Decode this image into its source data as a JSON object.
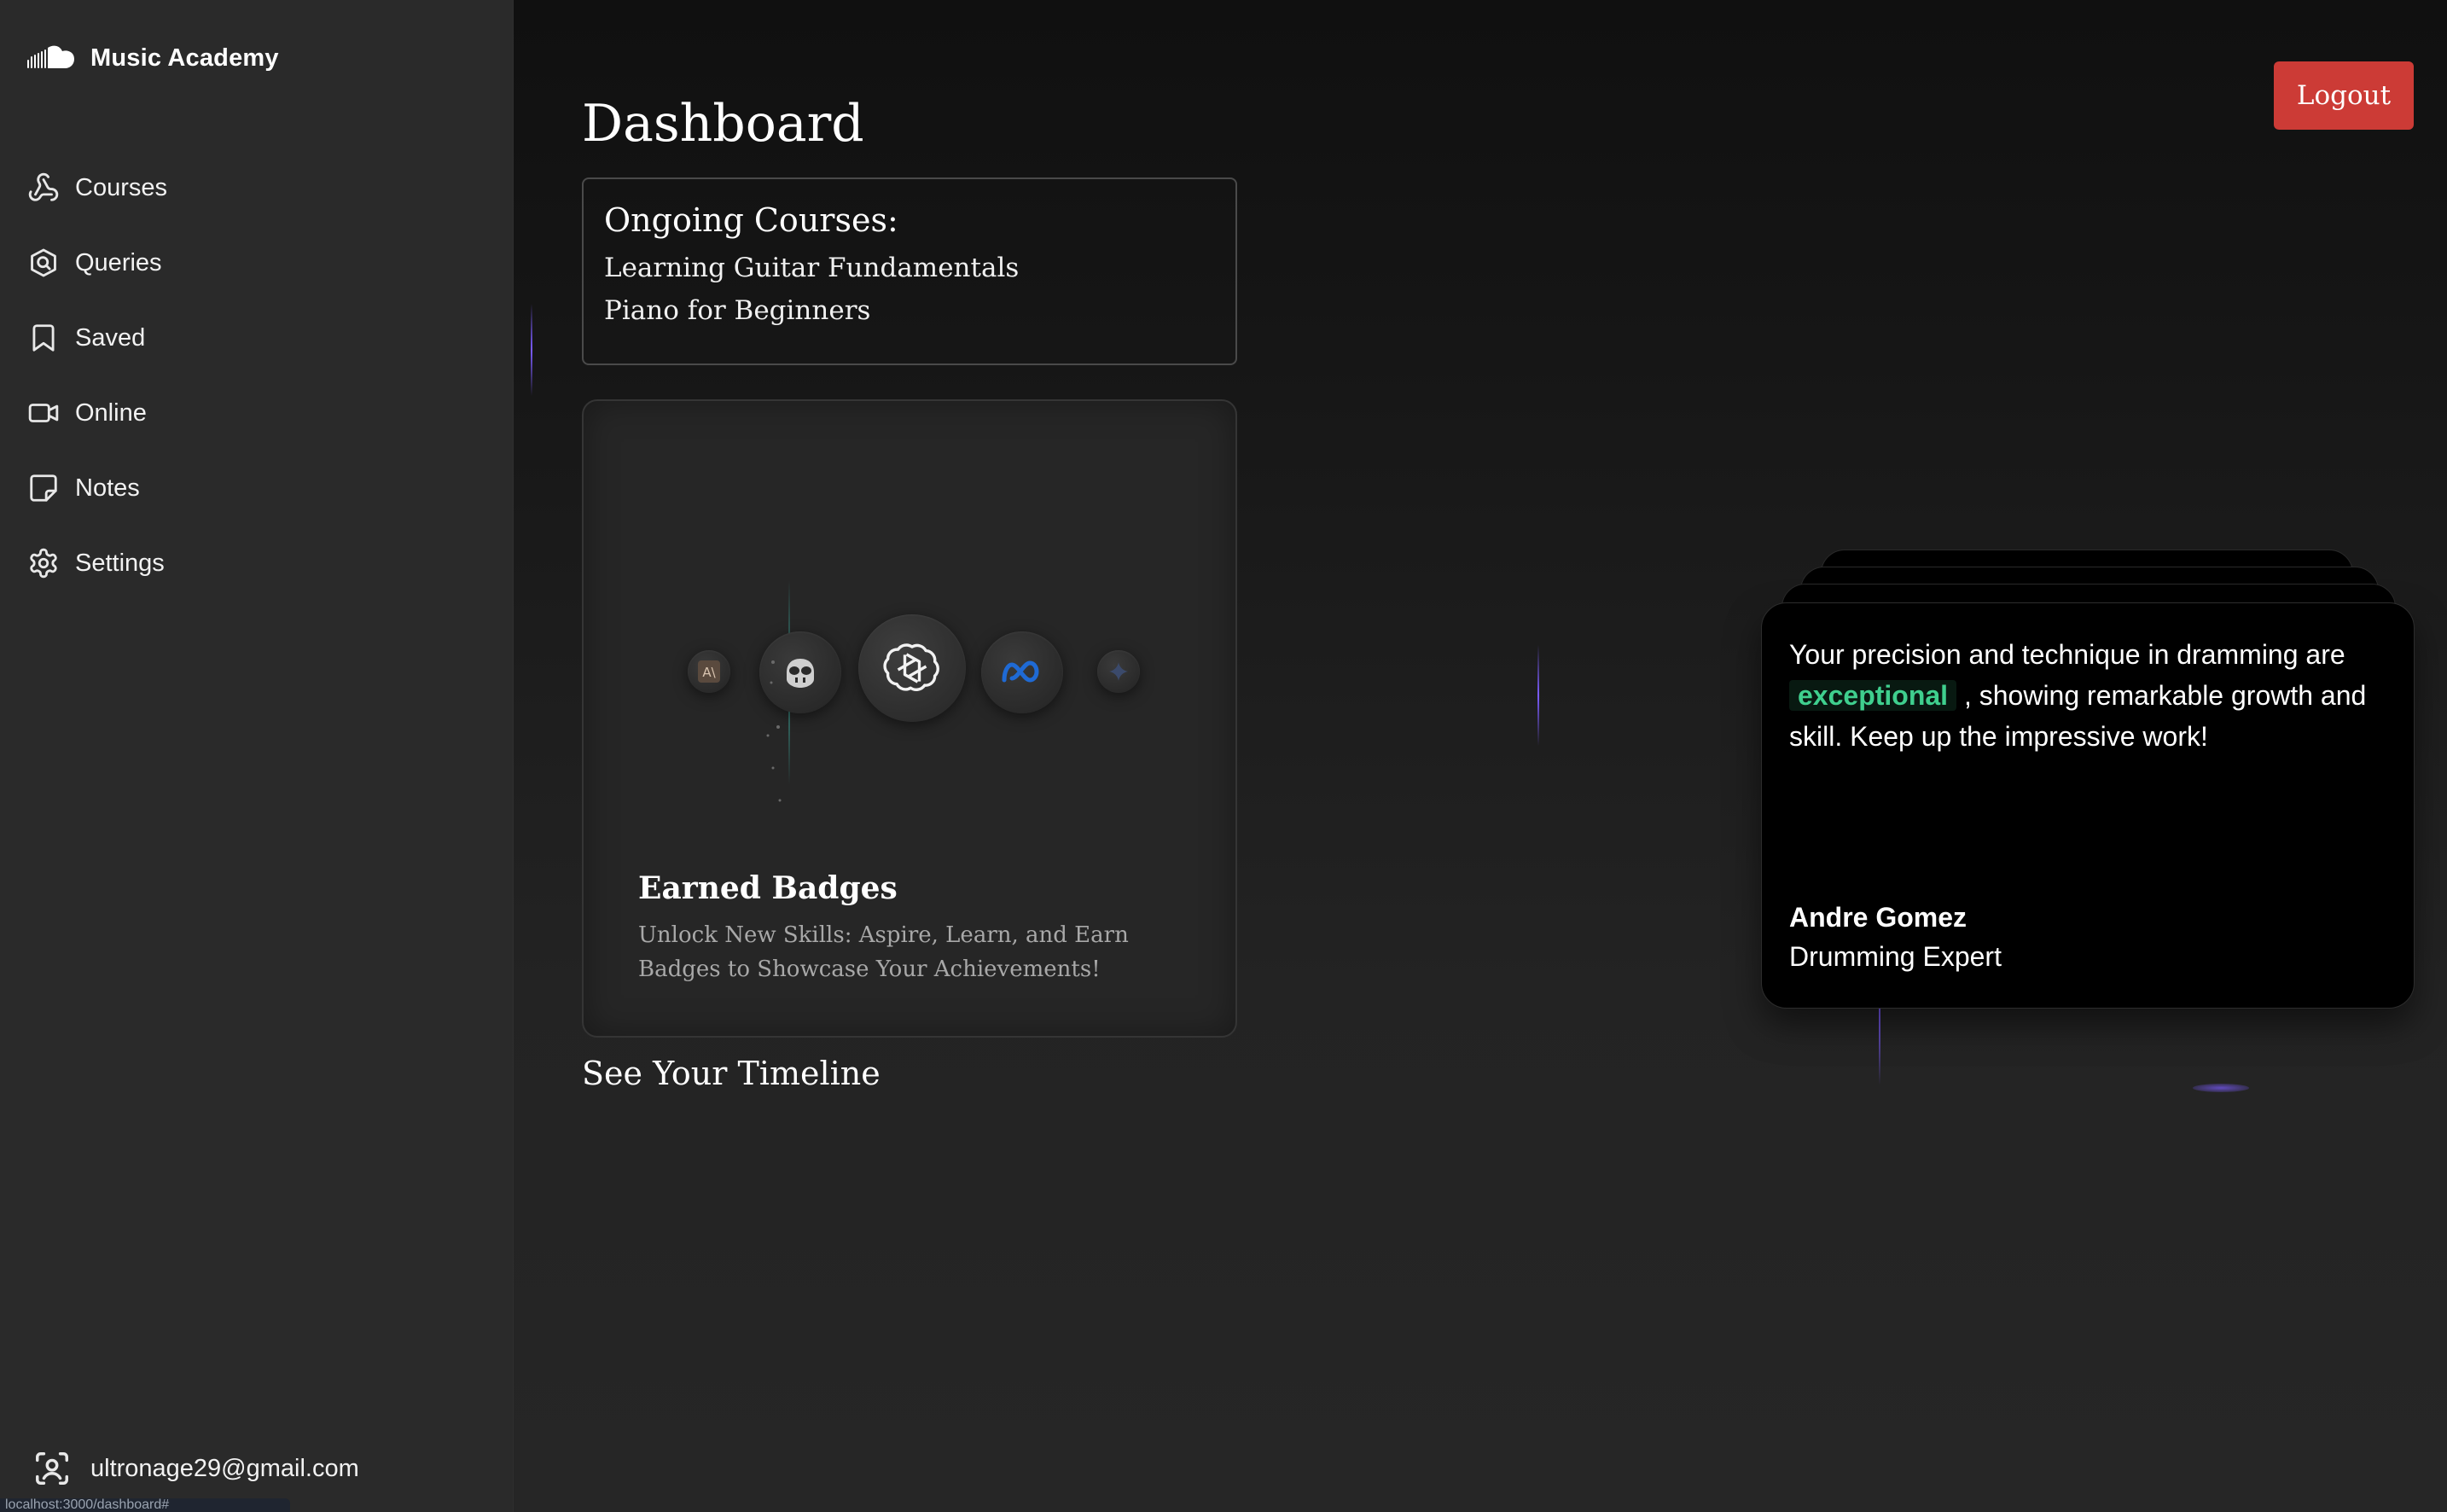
{
  "app": {
    "name": "Music Academy"
  },
  "sidebar": {
    "items": [
      {
        "label": "Courses",
        "icon": "webhook-icon"
      },
      {
        "label": "Queries",
        "icon": "search-circle-icon"
      },
      {
        "label": "Saved",
        "icon": "bookmark-icon"
      },
      {
        "label": "Online",
        "icon": "video-icon"
      },
      {
        "label": "Notes",
        "icon": "sticky-note-icon"
      },
      {
        "label": "Settings",
        "icon": "gear-icon"
      }
    ],
    "user_email": "ultronage29@gmail.com",
    "status_url": "localhost:3000/dashboard#"
  },
  "header": {
    "title": "Dashboard",
    "logout_label": "Logout"
  },
  "ongoing": {
    "heading": "Ongoing Courses:",
    "courses": [
      "Learning Guitar Fundamentals",
      "Piano for Beginners"
    ]
  },
  "badges": {
    "title": "Earned Badges",
    "description": "Unlock New Skills: Aspire, Learn, and Earn Badges to Showcase Your Achievements!",
    "icons": [
      "anthropic-icon",
      "copilot-icon",
      "openai-icon",
      "meta-icon",
      "gemini-sparkle-icon"
    ]
  },
  "timeline": {
    "label": "See Your Timeline"
  },
  "testimonial": {
    "quote_before": "Your precision and technique in dramming are ",
    "highlight": "exceptional",
    "quote_after": " , showing remarkable growth and skill. Keep up the impressive work!",
    "author": "Andre Gomez",
    "role": "Drumming Expert"
  },
  "colors": {
    "accent_red": "#cc3b36",
    "highlight_green": "#3fcf8e",
    "sidebar_bg": "#2a2a2a",
    "beam_purple": "#7b5cff"
  }
}
